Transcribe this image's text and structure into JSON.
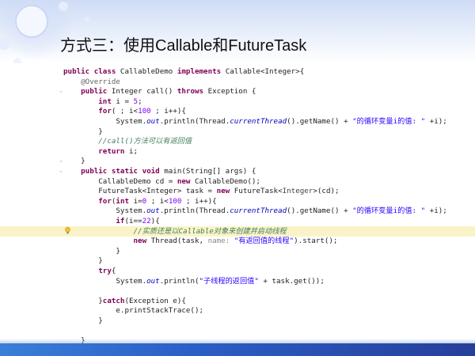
{
  "slide": {
    "title": "方式三：使用Callable和FutureTask"
  },
  "code": {
    "lines": [
      [
        {
          "t": "public class ",
          "c": "kw"
        },
        {
          "t": "CallableDemo ",
          "c": ""
        },
        {
          "t": "implements ",
          "c": "kw"
        },
        {
          "t": "Callable<Integer>{",
          "c": ""
        }
      ],
      [
        {
          "t": "    @Override",
          "c": "ann"
        }
      ],
      [
        {
          "t": "    public ",
          "c": "kw"
        },
        {
          "t": "Integer call() ",
          "c": ""
        },
        {
          "t": "throws ",
          "c": "kw"
        },
        {
          "t": "Exception {",
          "c": ""
        }
      ],
      [
        {
          "t": "        int ",
          "c": "kw"
        },
        {
          "t": "i = ",
          "c": ""
        },
        {
          "t": "5",
          "c": "num"
        },
        {
          "t": ";",
          "c": ""
        }
      ],
      [
        {
          "t": "        for",
          "c": "kw"
        },
        {
          "t": "( ; i<",
          "c": ""
        },
        {
          "t": "100",
          "c": "num"
        },
        {
          "t": " ; i++){",
          "c": ""
        }
      ],
      [
        {
          "t": "            System.",
          "c": ""
        },
        {
          "t": "out",
          "c": "fld"
        },
        {
          "t": ".println(Thread.",
          "c": ""
        },
        {
          "t": "currentThread",
          "c": "fld"
        },
        {
          "t": "().getName() + ",
          "c": ""
        },
        {
          "t": "\"的循环变量i的值: \"",
          "c": "str"
        },
        {
          "t": " +i);",
          "c": ""
        }
      ],
      [
        {
          "t": "        }",
          "c": ""
        }
      ],
      [
        {
          "t": "        //call()方法可以有返回值",
          "c": "cmt"
        }
      ],
      [
        {
          "t": "        return ",
          "c": "kw"
        },
        {
          "t": "i;",
          "c": ""
        }
      ],
      [
        {
          "t": "    }",
          "c": ""
        }
      ],
      [
        {
          "t": "    public static void ",
          "c": "kw"
        },
        {
          "t": "main(String[] args) {",
          "c": ""
        }
      ],
      [
        {
          "t": "        CallableDemo cd = ",
          "c": ""
        },
        {
          "t": "new ",
          "c": "kw"
        },
        {
          "t": "CallableDemo();",
          "c": ""
        }
      ],
      [
        {
          "t": "        FutureTask<Integer> task = ",
          "c": ""
        },
        {
          "t": "new ",
          "c": "kw"
        },
        {
          "t": "FutureTask<",
          "c": ""
        },
        {
          "t": "Integer",
          "c": "gen"
        },
        {
          "t": ">(cd);",
          "c": ""
        }
      ],
      [
        {
          "t": "        for",
          "c": "kw"
        },
        {
          "t": "(",
          "c": ""
        },
        {
          "t": "int ",
          "c": "kw"
        },
        {
          "t": "i=",
          "c": ""
        },
        {
          "t": "0",
          "c": "num"
        },
        {
          "t": " ; i<",
          "c": ""
        },
        {
          "t": "100",
          "c": "num"
        },
        {
          "t": " ; i++){",
          "c": ""
        }
      ],
      [
        {
          "t": "            System.",
          "c": ""
        },
        {
          "t": "out",
          "c": "fld"
        },
        {
          "t": ".println(Thread.",
          "c": ""
        },
        {
          "t": "currentThread",
          "c": "fld"
        },
        {
          "t": "().getName() + ",
          "c": ""
        },
        {
          "t": "\"的循环变量i的值: \"",
          "c": "str"
        },
        {
          "t": " +i);",
          "c": ""
        }
      ],
      [
        {
          "t": "            if",
          "c": "kw"
        },
        {
          "t": "(i==",
          "c": ""
        },
        {
          "t": "22",
          "c": "num"
        },
        {
          "t": "){",
          "c": ""
        }
      ],
      [
        {
          "t": "                //实质还是以Callable对象来创建并启动线程",
          "c": "cmt"
        }
      ],
      [
        {
          "t": "                new ",
          "c": "kw"
        },
        {
          "t": "Thread(task, ",
          "c": ""
        },
        {
          "t": "name: ",
          "c": "hint"
        },
        {
          "t": "\"有返回值的线程\"",
          "c": "str"
        },
        {
          "t": ").start();",
          "c": ""
        }
      ],
      [
        {
          "t": "            }",
          "c": ""
        }
      ],
      [
        {
          "t": "        }",
          "c": ""
        }
      ],
      [
        {
          "t": "        try",
          "c": "kw"
        },
        {
          "t": "{",
          "c": ""
        }
      ],
      [
        {
          "t": "            System.",
          "c": ""
        },
        {
          "t": "out",
          "c": "fld"
        },
        {
          "t": ".println(",
          "c": ""
        },
        {
          "t": "\"子线程的返回值\"",
          "c": "str"
        },
        {
          "t": " + task.get());",
          "c": ""
        }
      ],
      [
        {
          "t": "",
          "c": ""
        }
      ],
      [
        {
          "t": "        }",
          "c": ""
        },
        {
          "t": "catch",
          "c": "kw"
        },
        {
          "t": "(Exception e){",
          "c": ""
        }
      ],
      [
        {
          "t": "            e.printStackTrace();",
          "c": ""
        }
      ],
      [
        {
          "t": "        }",
          "c": ""
        }
      ],
      [
        {
          "t": "",
          "c": ""
        }
      ],
      [
        {
          "t": "    }",
          "c": ""
        }
      ]
    ]
  },
  "colors": {
    "keyword": "#7f0055",
    "annotation": "#646464",
    "string": "#2a00ff",
    "number": "#8000ff",
    "comment": "#3f7f5f",
    "highlight_line": "#fbf3c8",
    "bottom_bar": "#2b5fc7"
  },
  "icons": {
    "gutter_hint": "lightbulb-icon"
  },
  "highlight_line_index": 16
}
